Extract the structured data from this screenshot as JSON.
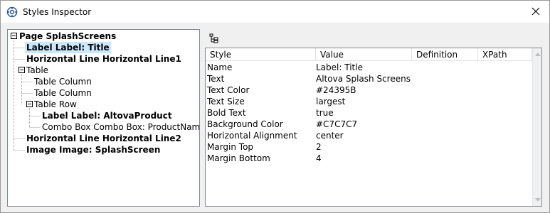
{
  "window": {
    "title": "Styles Inspector",
    "icon": "settings-icon",
    "close_icon": "close-icon"
  },
  "tree": {
    "nodes": [
      {
        "label": "Page SplashScreens",
        "bold": true,
        "level": 0,
        "expandable": true
      },
      {
        "label": "Label Label: Title",
        "bold": true,
        "level": 1,
        "selected": true
      },
      {
        "label": "Horizontal Line Horizontal Line1",
        "bold": true,
        "level": 1
      },
      {
        "label": "Table",
        "bold": false,
        "level": 1,
        "expandable": true
      },
      {
        "label": "Table Column",
        "bold": false,
        "level": 2
      },
      {
        "label": "Table Column",
        "bold": false,
        "level": 2
      },
      {
        "label": "Table Row",
        "bold": false,
        "level": 2,
        "expandable": true
      },
      {
        "label": "Label Label: AltovaProduct",
        "bold": true,
        "level": 3
      },
      {
        "label": "Combo Box Combo Box: ProductName",
        "bold": false,
        "level": 3
      },
      {
        "label": "Horizontal Line Horizontal Line2",
        "bold": true,
        "level": 1
      },
      {
        "label": "Image Image: SplashScreen",
        "bold": true,
        "level": 1
      }
    ]
  },
  "toolbar": {
    "tree_button_icon": "tree-view-icon"
  },
  "grid": {
    "columns": [
      "Style",
      "Value",
      "Definition",
      "XPath"
    ],
    "rows": [
      {
        "style": "Name",
        "value": "Label: Title"
      },
      {
        "style": "Text",
        "value": "Altova Splash Screens"
      },
      {
        "style": "Text Color",
        "value": "#24395B"
      },
      {
        "style": "Text Size",
        "value": "largest"
      },
      {
        "style": "Bold Text",
        "value": "true"
      },
      {
        "style": "Background Color",
        "value": "#C7C7C7"
      },
      {
        "style": "Horizontal Alignment",
        "value": "center"
      },
      {
        "style": "Margin Top",
        "value": "2"
      },
      {
        "style": "Margin Bottom",
        "value": "4"
      }
    ]
  },
  "colors": {
    "selection": "#cce8ff",
    "border": "#828790"
  }
}
